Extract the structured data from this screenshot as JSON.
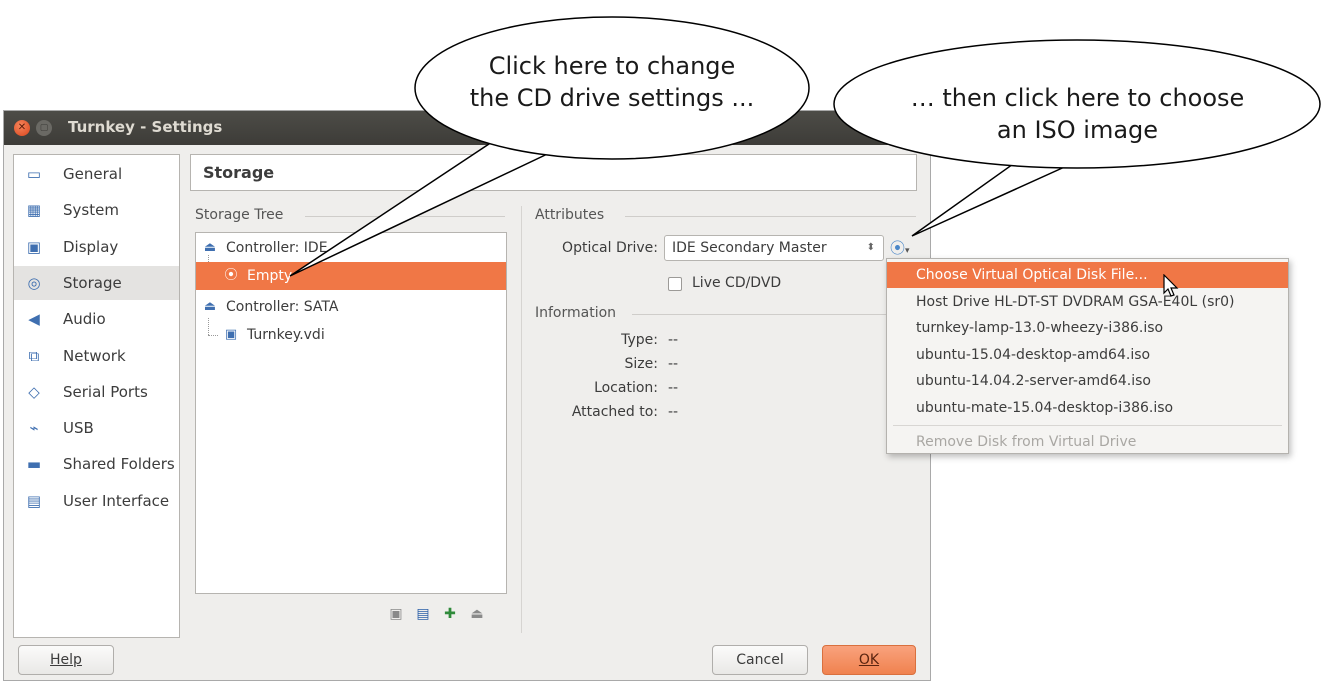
{
  "window": {
    "title": "Turnkey - Settings",
    "heading": "Storage"
  },
  "sidebar": {
    "items": [
      {
        "label": "General",
        "icon": "monitor-icon",
        "glyph": "▭"
      },
      {
        "label": "System",
        "icon": "chip-icon",
        "glyph": "▦"
      },
      {
        "label": "Display",
        "icon": "display-icon",
        "glyph": "▣"
      },
      {
        "label": "Storage",
        "icon": "storage-icon",
        "glyph": "◎",
        "active": true
      },
      {
        "label": "Audio",
        "icon": "speaker-icon",
        "glyph": "◀"
      },
      {
        "label": "Network",
        "icon": "network-icon",
        "glyph": "⧉"
      },
      {
        "label": "Serial Ports",
        "icon": "serial-port-icon",
        "glyph": "◇"
      },
      {
        "label": "USB",
        "icon": "usb-icon",
        "glyph": "⌁"
      },
      {
        "label": "Shared Folders",
        "icon": "folder-icon",
        "glyph": "▬"
      },
      {
        "label": "User Interface",
        "icon": "window-icon",
        "glyph": "▤"
      }
    ]
  },
  "storage_tree": {
    "label": "Storage Tree",
    "rows": [
      {
        "label": "Controller: IDE",
        "icon": "controller-icon",
        "glyph": "⏏"
      },
      {
        "label": "Empty",
        "icon": "cd-icon",
        "glyph": "⦿",
        "selected": true
      },
      {
        "label": "Controller: SATA",
        "icon": "controller-icon",
        "glyph": "⏏"
      },
      {
        "label": "Turnkey.vdi",
        "icon": "hard-disk-icon",
        "glyph": "▣"
      }
    ],
    "tools": [
      {
        "icon": "add-attachment-icon",
        "glyph": "▣"
      },
      {
        "icon": "remove-attachment-icon",
        "glyph": "▤"
      },
      {
        "icon": "add-controller-icon",
        "glyph": "✚"
      },
      {
        "icon": "remove-controller-icon",
        "glyph": "⏏"
      }
    ]
  },
  "attributes": {
    "label": "Attributes",
    "optical_drive_label": "Optical Drive:",
    "optical_drive_value": "IDE Secondary Master",
    "live_cd_label": "Live CD/DVD"
  },
  "information": {
    "label": "Information",
    "rows": [
      {
        "key": "Type:",
        "value": "--"
      },
      {
        "key": "Size:",
        "value": "--"
      },
      {
        "key": "Location:",
        "value": "--"
      },
      {
        "key": "Attached to:",
        "value": "--"
      }
    ]
  },
  "buttons": {
    "help": "Help",
    "cancel": "Cancel",
    "ok": "OK"
  },
  "menu": {
    "items": [
      {
        "label": "Choose Virtual Optical Disk File...",
        "highlighted": true
      },
      {
        "label": "Host Drive HL-DT-ST DVDRAM GSA-E40L  (sr0)"
      },
      {
        "label": "turnkey-lamp-13.0-wheezy-i386.iso"
      },
      {
        "label": "ubuntu-15.04-desktop-amd64.iso"
      },
      {
        "label": "ubuntu-14.04.2-server-amd64.iso"
      },
      {
        "label": "ubuntu-mate-15.04-desktop-i386.iso"
      }
    ],
    "remove_label": "Remove Disk from Virtual Drive"
  },
  "callouts": {
    "left": [
      "Click here to change",
      "the CD drive settings ..."
    ],
    "right": [
      "… then click here to choose",
      "an ISO image"
    ]
  },
  "colors": {
    "accent": "#f07746",
    "titlebar": "#3d3c38",
    "window_bg": "#efeeec"
  }
}
